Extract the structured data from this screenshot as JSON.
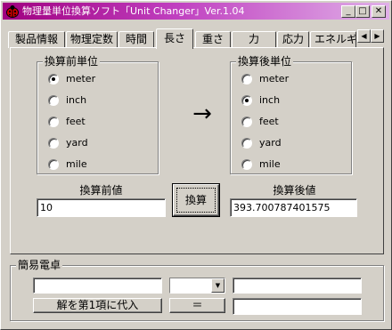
{
  "window": {
    "title": "物理量単位換算ソフト「Unit Changer」Ver.1.04",
    "min_label": "_",
    "max_label": "□",
    "close_label": "✕"
  },
  "tabs": [
    {
      "label": "製品情報",
      "active": false
    },
    {
      "label": "物理定数",
      "active": false
    },
    {
      "label": "時間",
      "active": false
    },
    {
      "label": "長さ",
      "active": true
    },
    {
      "label": "重さ",
      "active": false
    },
    {
      "label": "力",
      "active": false
    },
    {
      "label": "応力",
      "active": false
    },
    {
      "label": "エネルギ",
      "active": false
    }
  ],
  "tab_scroll": {
    "left": "◀",
    "right": "▶"
  },
  "from_group": {
    "title": "換算前単位",
    "options": [
      "meter",
      "inch",
      "feet",
      "yard",
      "mile"
    ],
    "selected": "meter"
  },
  "to_group": {
    "title": "換算後単位",
    "options": [
      "meter",
      "inch",
      "feet",
      "yard",
      "mile"
    ],
    "selected": "inch"
  },
  "arrow": "→",
  "input_label": "換算前値",
  "input_value": "10",
  "convert_button": "換算",
  "output_label": "換算後値",
  "output_value": "393.700787401575",
  "calculator": {
    "title": "簡易電卓",
    "operand1": "",
    "operator": "",
    "operand2": "",
    "result": "",
    "assign_button": "解を第1項に代入",
    "equals_button": "＝",
    "dropdown_arrow": "▼"
  },
  "colors": {
    "titlebar_start": "#a00080",
    "titlebar_end": "#e0b0e8",
    "face": "#d4d0c8"
  }
}
